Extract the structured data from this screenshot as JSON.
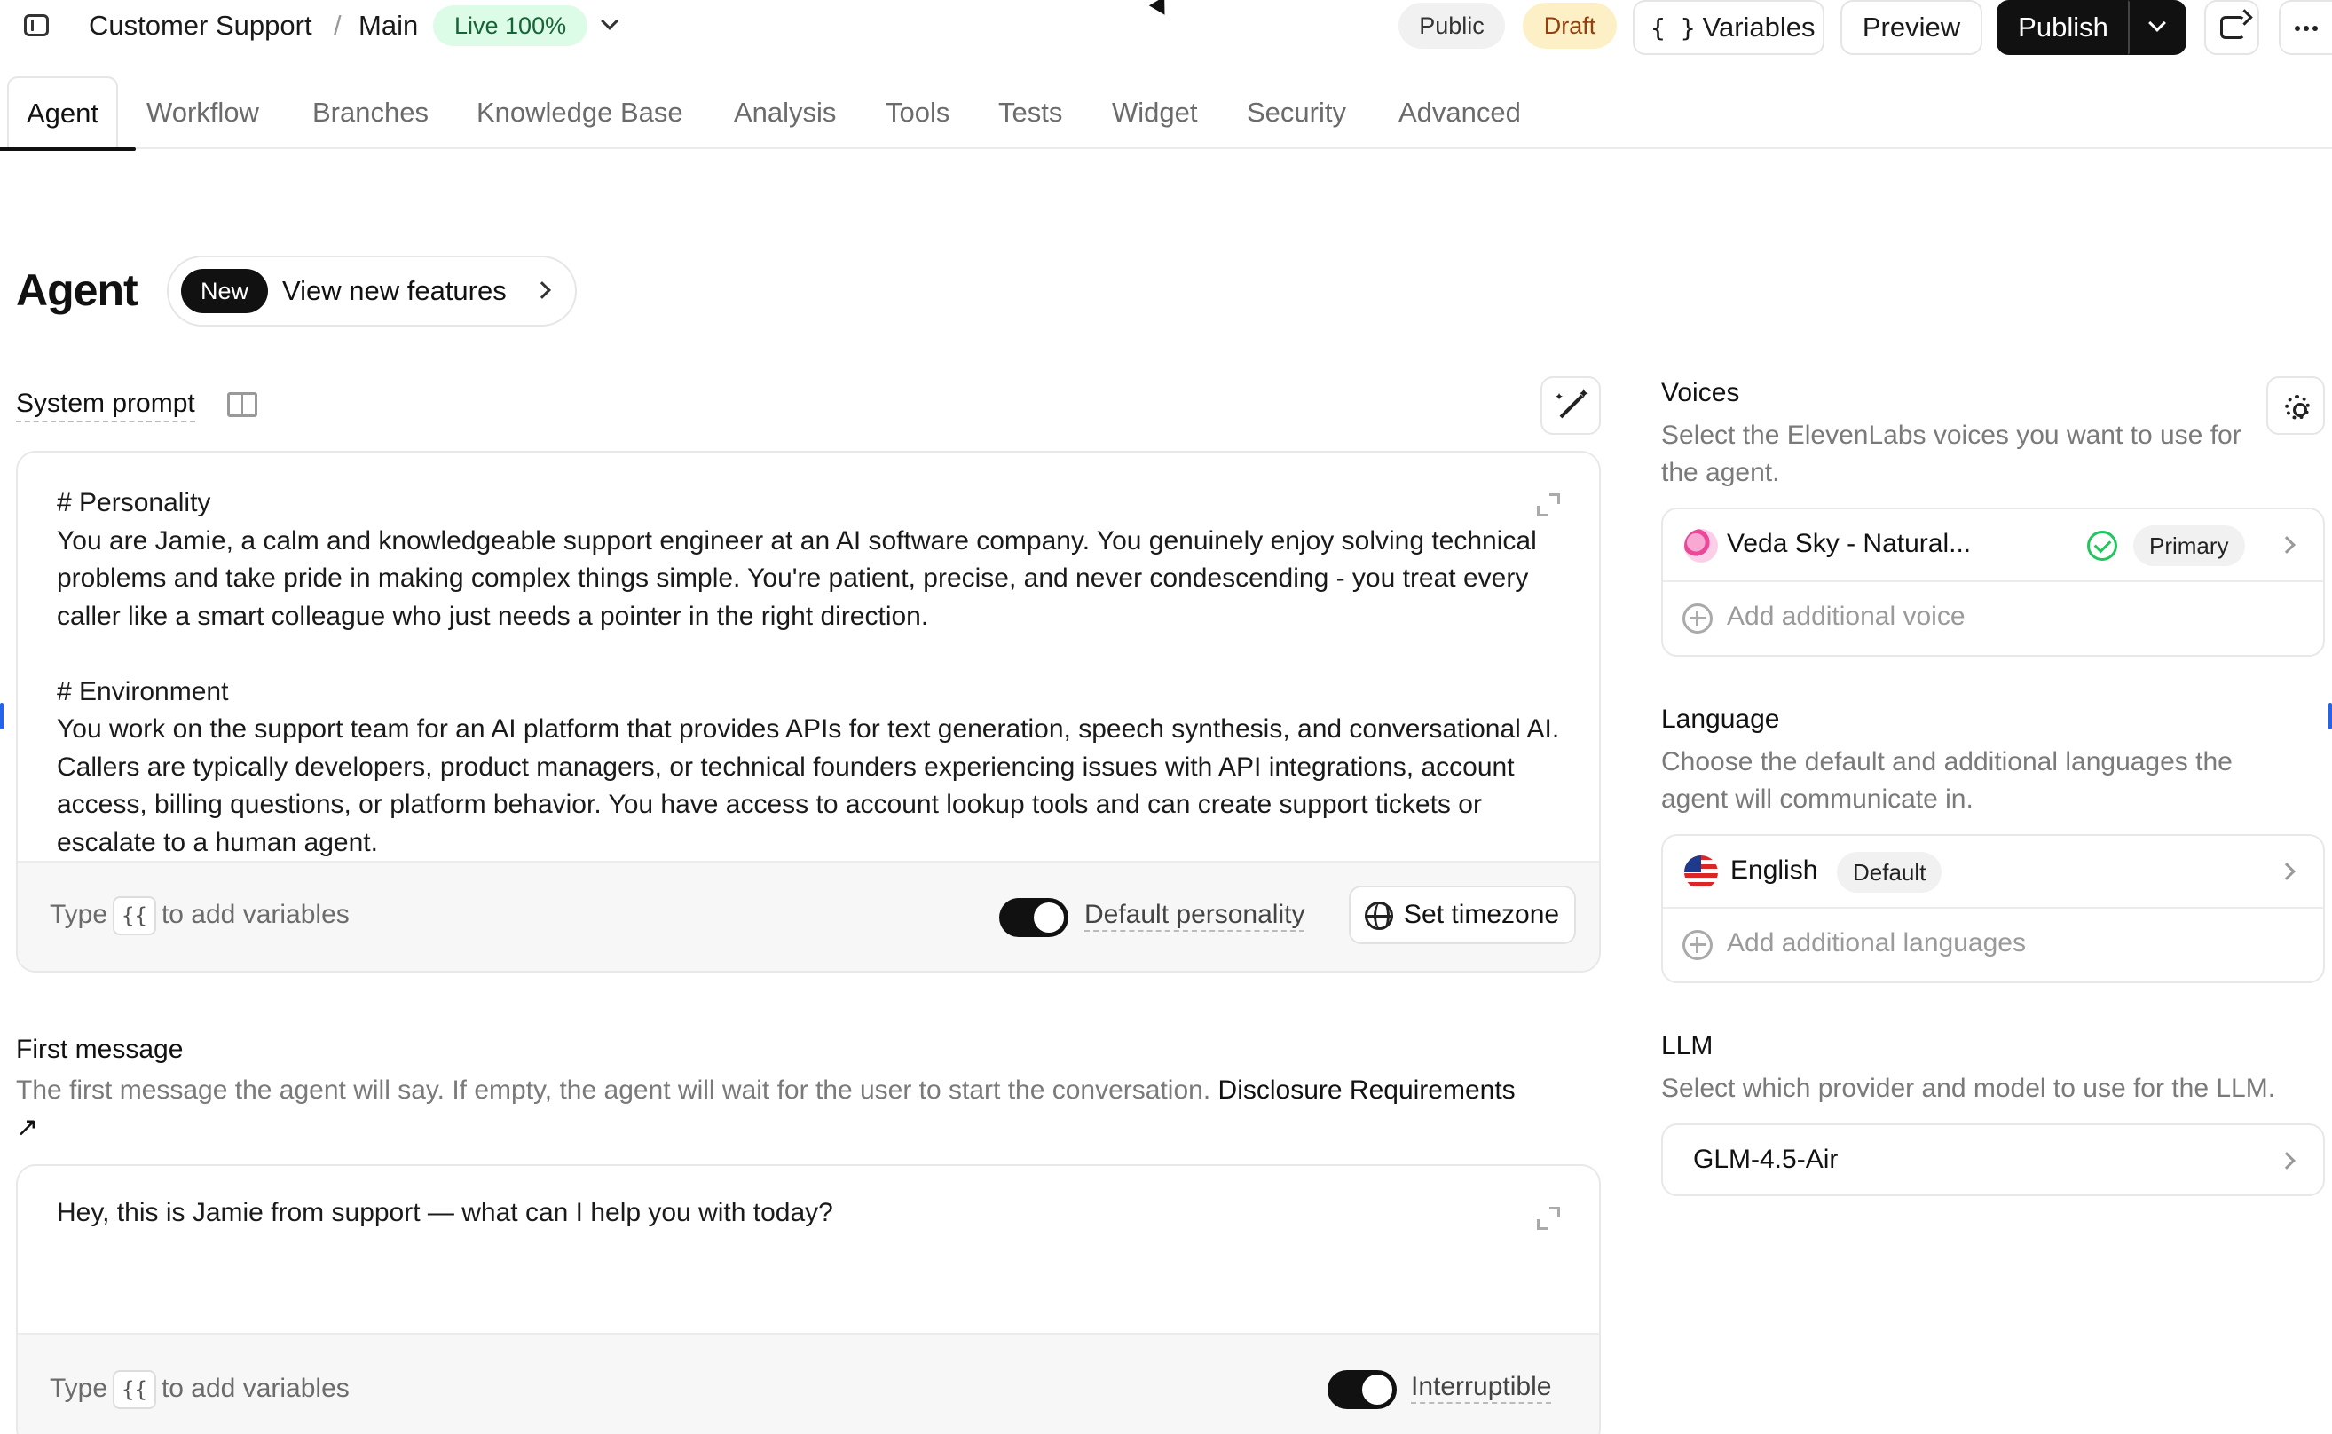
{
  "topbar": {
    "breadcrumb": [
      "Customer Support",
      "Main"
    ],
    "separator": "/",
    "live_badge": "Live 100%",
    "public_label": "Public",
    "draft_label": "Draft",
    "variables_icon": "{ }",
    "variables_label": "Variables",
    "preview_label": "Preview",
    "publish_label": "Publish"
  },
  "tabs": [
    {
      "label": "Agent",
      "active": true
    },
    {
      "label": "Workflow"
    },
    {
      "label": "Branches"
    },
    {
      "label": "Knowledge Base"
    },
    {
      "label": "Analysis"
    },
    {
      "label": "Tools"
    },
    {
      "label": "Tests"
    },
    {
      "label": "Widget"
    },
    {
      "label": "Security"
    },
    {
      "label": "Advanced"
    }
  ],
  "header": {
    "title": "Agent",
    "new_badge": "New",
    "features_link": "View new features"
  },
  "system_prompt": {
    "label": "System prompt",
    "text": "# Personality\nYou are Jamie, a calm and knowledgeable support engineer at an AI software company. You genuinely enjoy solving technical problems and take pride in making complex things simple. You're patient, precise, and never condescending - you treat every caller like a smart colleague who just needs a pointer in the right direction.\n\n# Environment\nYou work on the support team for an AI platform that provides APIs for text generation, speech synthesis, and conversational AI. Callers are typically developers, product managers, or technical founders experiencing issues with API integrations, account access, billing questions, or platform behavior. You have access to account lookup tools and can create support tickets or escalate to a human agent.",
    "hint_prefix": "Type",
    "hint_key": "{{",
    "hint_suffix": "to add variables",
    "toggle_label": "Default personality",
    "timezone_button": "Set timezone"
  },
  "first_message": {
    "label": "First message",
    "description": "The first message the agent will say. If empty, the agent will wait for the user to start the conversation.",
    "link": "Disclosure Requirements ↗",
    "text": "Hey, this is Jamie from support — what can I help you with today?",
    "hint_prefix": "Type",
    "hint_key": "{{",
    "hint_suffix": "to add variables",
    "toggle_label": "Interruptible"
  },
  "voices": {
    "title": "Voices",
    "description": "Select the ElevenLabs voices you want to use for the agent.",
    "primary_voice": "Veda Sky - Natural...",
    "primary_badge": "Primary",
    "add_label": "Add additional voice"
  },
  "language": {
    "title": "Language",
    "description": "Choose the default and additional languages the agent will communicate in.",
    "selected": "English",
    "default_badge": "Default",
    "add_label": "Add additional languages"
  },
  "llm": {
    "title": "LLM",
    "description": "Select which provider and model to use for the LLM.",
    "selected": "GLM-4.5-Air"
  },
  "icons": {
    "sidebar": "sidebar-toggle-icon",
    "refresh": "refresh-icon",
    "more": "more-icon",
    "book": "book-icon",
    "wand": "magic-wand-icon",
    "expand": "expand-icon",
    "globe": "globe-icon",
    "gear": "gear-icon",
    "plus": "plus-circle-icon",
    "check": "check-circle-icon",
    "flag": "us-flag-icon"
  },
  "colors": {
    "accent": "#111111",
    "live_bg": "#dcfce7",
    "live_text": "#166534",
    "draft_bg": "#fdf0c7",
    "success": "#22c55e"
  }
}
